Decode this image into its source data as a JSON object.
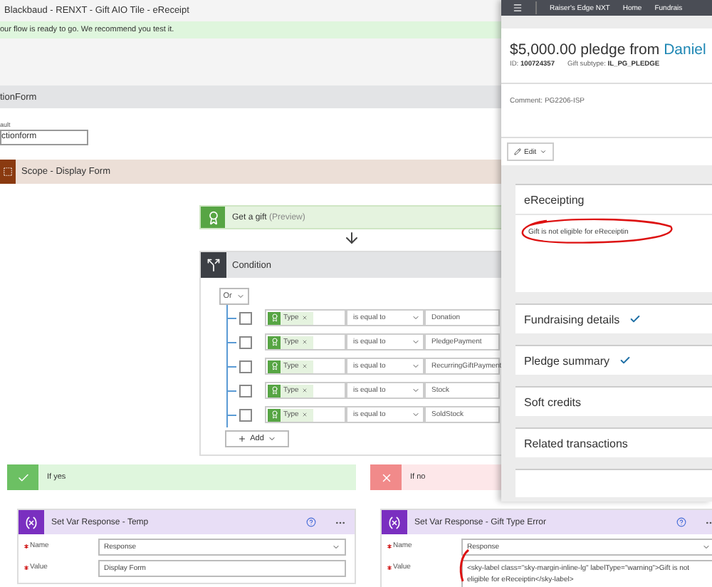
{
  "window": {
    "title": "Blackbaud - RENXT - Gift AIO Tile - eReceipt"
  },
  "banner": "our flow is ready to go. We recommend you test it.",
  "trigger": {
    "title": "tionForm",
    "field_label": "ault",
    "field_value": "ctionform"
  },
  "scope": {
    "title": "Scope - Display Form"
  },
  "get_gift": {
    "title": "Get a gift",
    "tag": "(Preview)"
  },
  "condition": {
    "title": "Condition",
    "group_operator": "Or",
    "add_label": "Add",
    "rows": [
      {
        "field": "Type",
        "operator": "is equal to",
        "value": "Donation",
        "checked": false
      },
      {
        "field": "Type",
        "operator": "is equal to",
        "value": "PledgePayment",
        "checked": false
      },
      {
        "field": "Type",
        "operator": "is equal to",
        "value": "RecurringGiftPayment",
        "checked": false
      },
      {
        "field": "Type",
        "operator": "is equal to",
        "value": "Stock",
        "checked": false
      },
      {
        "field": "Type",
        "operator": "is equal to",
        "value": "SoldStock",
        "checked": false
      }
    ]
  },
  "branches": [
    {
      "kind": "yes",
      "title": "If yes",
      "action": {
        "title": "Set Var Response - Temp",
        "fields": [
          {
            "label": "Name",
            "value": "Response",
            "kind": "dropdown",
            "required": true
          },
          {
            "label": "Value",
            "value": "Display Form",
            "kind": "text",
            "required": true
          }
        ]
      }
    },
    {
      "kind": "no",
      "title": "If no",
      "action": {
        "title": "Set Var Response - Gift Type Error",
        "fields": [
          {
            "label": "Name",
            "value": "Response",
            "kind": "dropdown",
            "required": true
          },
          {
            "label": "Value",
            "value": "<sky-label class=\"sky-margin-inline-lg\" labelType=\"warning\">Gift is not eligible for eReceiptin</sky-label>",
            "kind": "text",
            "required": true
          }
        ]
      }
    }
  ],
  "panel": {
    "product": "Raiser's Edge NXT",
    "nav_links": [
      "Home",
      "Fundrais"
    ],
    "title": "$5,000.00 pledge from",
    "donor": "Daniel",
    "id_label": "ID:",
    "id": "100724357",
    "subtype_label": "Gift subtype:",
    "subtype": "IL_PG_PLEDGE",
    "comment": "Comment: PG2206-ISP",
    "edit": "Edit",
    "sections": [
      {
        "title": "eReceipting",
        "body": "Gift is not eligible for eReceiptin",
        "complete": false
      },
      {
        "title": "Fundraising details",
        "complete": true
      },
      {
        "title": "Pledge summary",
        "complete": true
      },
      {
        "title": "Soft credits",
        "complete": false
      },
      {
        "title": "Related transactions",
        "complete": false
      }
    ]
  }
}
